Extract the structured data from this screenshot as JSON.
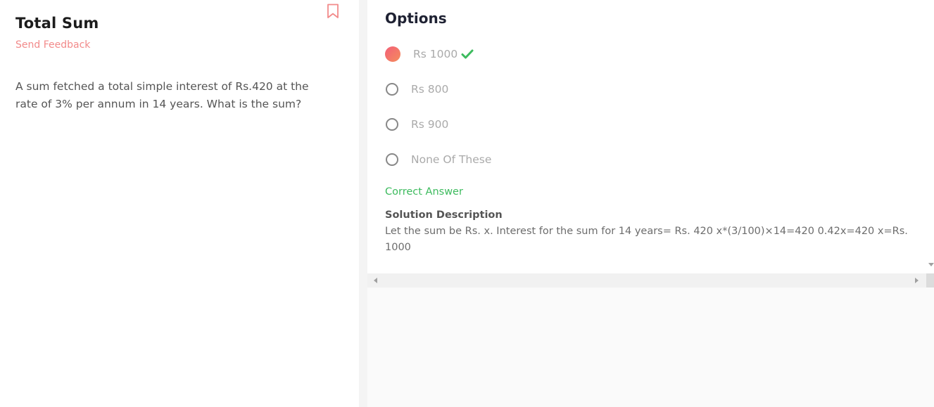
{
  "question": {
    "title": "Total Sum",
    "feedback_label": "Send Feedback",
    "text": "A sum fetched a total simple interest of Rs.420 at the rate of 3% per annum in 14 years. What is the sum?"
  },
  "options_panel": {
    "title": "Options",
    "options": [
      {
        "label": "Rs 1000",
        "selected": true,
        "correct": true
      },
      {
        "label": "Rs 800",
        "selected": false,
        "correct": false
      },
      {
        "label": "Rs 900",
        "selected": false,
        "correct": false
      },
      {
        "label": "None Of These",
        "selected": false,
        "correct": false
      }
    ],
    "result_label": "Correct Answer",
    "solution_title": "Solution Description",
    "solution_text": "Let the sum be Rs. x. Interest for the sum for 14 years= Rs. 420 x*(3/100)×14=420 0.42x=420 x=Rs. 1000"
  },
  "colors": {
    "accent": "#f28a8a",
    "correct": "#3dbb5e",
    "radio_gradient_start": "#f35f78",
    "radio_gradient_end": "#f48c5c"
  },
  "icons": {
    "bookmark": "bookmark-icon",
    "check": "check-icon"
  }
}
